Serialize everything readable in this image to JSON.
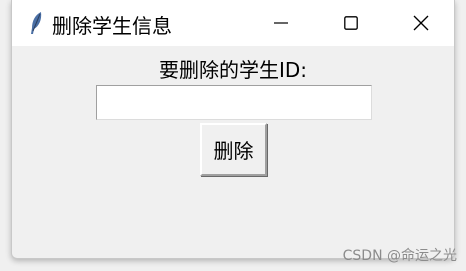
{
  "window": {
    "title": "删除学生信息",
    "icon": "feather-icon"
  },
  "titlebar_controls": {
    "minimize": "minimize-icon",
    "maximize": "maximize-icon",
    "close": "close-icon"
  },
  "form": {
    "prompt_label": "要删除的学生ID:",
    "id_input_value": "",
    "delete_button_label": "删除"
  },
  "watermark": "CSDN @命运之光",
  "colors": {
    "window_bg": "#f0f0f0",
    "titlebar_bg": "#ffffff",
    "input_bg": "#ffffff",
    "watermark_text": "#8c8c8c"
  }
}
